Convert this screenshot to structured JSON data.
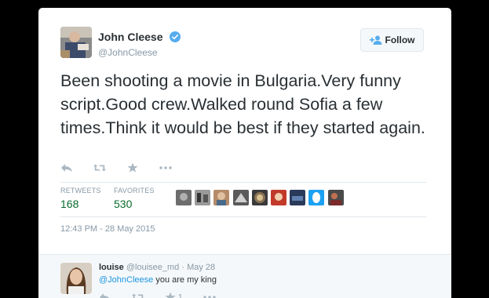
{
  "tweet": {
    "author": {
      "name": "John Cleese",
      "handle": "@JohnCleese",
      "verified": true
    },
    "follow_label": "Follow",
    "text": "Been shooting a movie in Bulgaria.Very funny script.Good crew.Walked round Sofia a few times.Think it would be best if they started again.",
    "actions": [
      "reply-icon",
      "retweet-icon",
      "favorite-icon",
      "more-icon"
    ],
    "stats": {
      "retweets_label": "RETWEETS",
      "retweets_count": "168",
      "favorites_label": "FAVORITES",
      "favorites_count": "530"
    },
    "timestamp": "12:43 PM - 28 May 2015"
  },
  "reply": {
    "name": "louise",
    "handle": "@louisee_md",
    "separator": "·",
    "date": "May 28",
    "mention": "@JohnCleese",
    "text": " you are my king",
    "favorite_count": "1"
  },
  "colors": {
    "accent": "#1b95e0",
    "stats_value": "#0a6b2d",
    "muted": "#8899a6",
    "text": "#292f33"
  }
}
